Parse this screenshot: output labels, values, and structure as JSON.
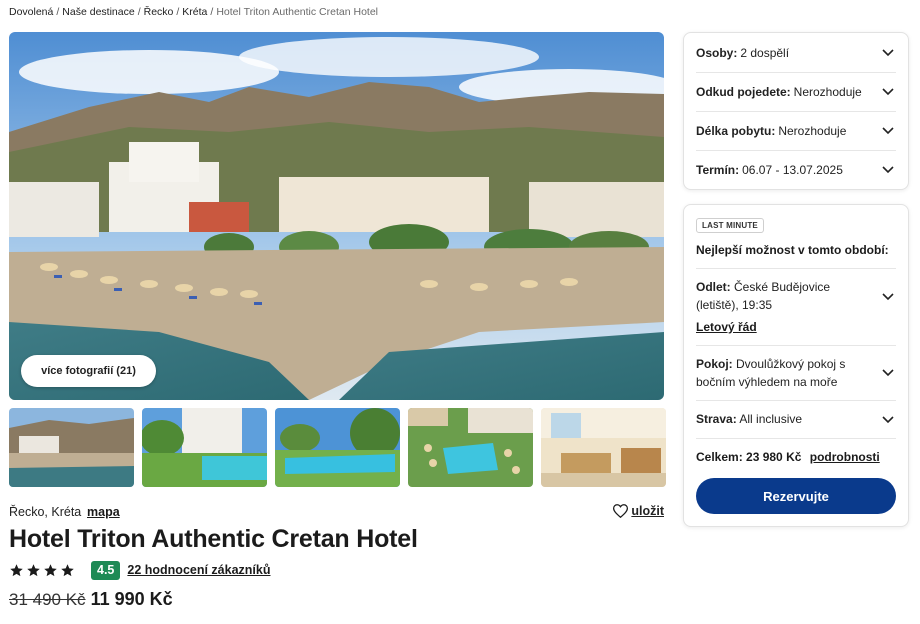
{
  "breadcrumb": {
    "items": [
      "Dovolená",
      "Naše destinace",
      "Řecko",
      "Kréta"
    ],
    "current": "Hotel Triton Authentic Cretan Hotel"
  },
  "gallery": {
    "more_photos_label": "více fotografií (21)"
  },
  "hotel": {
    "location": "Řecko, Kréta",
    "map_label": "mapa",
    "save_label": "uložit",
    "name": "Hotel Triton Authentic Cretan Hotel",
    "stars": 4,
    "score": "4.5",
    "reviews_label": "22 hodnocení zákazníků",
    "old_price": "31 490 Kč",
    "new_price": "11 990 Kč",
    "score_color": "#1e8a55"
  },
  "filters": {
    "persons": {
      "label": "Osoby:",
      "value": "2 dospělí"
    },
    "departure_from": {
      "label": "Odkud pojedete:",
      "value": "Nerozhoduje"
    },
    "length": {
      "label": "Délka pobytu:",
      "value": "Nerozhoduje"
    },
    "term": {
      "label": "Termín:",
      "value": "06.07 - 13.07.2025"
    }
  },
  "offer": {
    "badge": "LAST MINUTE",
    "best_option": "Nejlepší možnost v tomto období:",
    "departure_label": "Odlet:",
    "departure_value": "České Budějovice (letiště), 19:35",
    "schedule_link": "Letový řád",
    "room_label": "Pokoj:",
    "room_value": "Dvoulůžkový pokoj s bočním výhledem na moře",
    "board_label": "Strava:",
    "board_value": "All inclusive",
    "total_label": "Celkem:",
    "total_value": "23 980 Kč",
    "details_link": "podrobnosti",
    "reserve_label": "Rezervujte",
    "reserve_color": "#0a3a8c"
  }
}
